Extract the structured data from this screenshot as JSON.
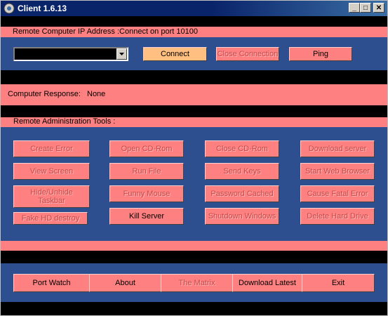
{
  "window": {
    "title": "Client 1.6.13"
  },
  "titlebar_buttons": {
    "minimize": "_",
    "maximize": "□",
    "close": "✕"
  },
  "connection": {
    "header": "Remote Computer IP Address :Connect on port 10100",
    "ip_value": "",
    "connect": "Connect",
    "close_connection": "Close Connection",
    "ping": "Ping"
  },
  "response": {
    "label": "Computer Response:",
    "value": "None"
  },
  "tools": {
    "header": "Remote Administration Tools :",
    "create_error": "Create Error",
    "view_screen": "View Screen",
    "hide_taskbar": "Hide/Unhide Taskbar",
    "fake_hd": "Fake HD destroy",
    "open_cdrom": "Open CD-Rom",
    "run_file": "Run File",
    "funny_mouse": "Funny Mouse",
    "kill_server": "Kill Server",
    "close_cdrom": "Close CD-Rom",
    "send_keys": "Send Keys",
    "password_cached": "Password Cached",
    "shutdown_windows": "Shutdown Windows",
    "download_server": "Download server",
    "start_web_browser": "Start Web Browser",
    "cause_fatal_error": "Cause Fatal Error",
    "delete_hard_drive": "Delete Hard Drive"
  },
  "bottom": {
    "port_watch": "Port Watch",
    "about": "About",
    "the_matrix": "The Matrix",
    "download_latest": "Download Latest",
    "exit": "Exit"
  },
  "colors": {
    "accent": "#ff8080",
    "panel": "#2e4f8f",
    "titlebar": "#0a246a",
    "highlight": "#ffbf80"
  }
}
